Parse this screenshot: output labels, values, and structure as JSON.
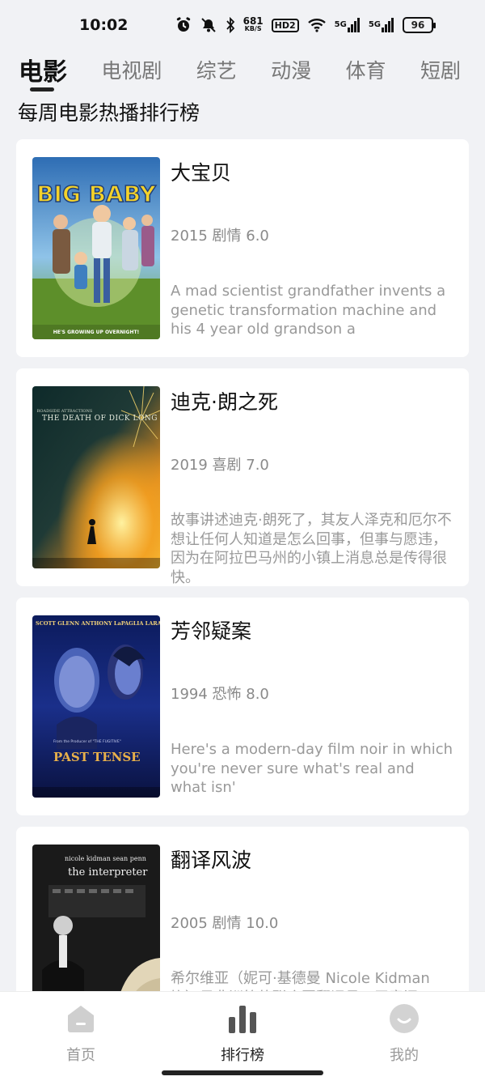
{
  "status_bar": {
    "time": "10:02",
    "net_speed_value": "681",
    "net_speed_unit": "KB/S",
    "hd_label": "HD2",
    "signal1_label": "5G",
    "signal2_label": "5G",
    "battery": "96"
  },
  "tabs": [
    {
      "label": "电影",
      "active": true
    },
    {
      "label": "电视剧"
    },
    {
      "label": "综艺"
    },
    {
      "label": "动漫"
    },
    {
      "label": "体育"
    },
    {
      "label": "短剧"
    }
  ],
  "section_title": "每周电影热播排行榜",
  "movies": [
    {
      "title": "大宝贝",
      "meta": "2015 剧情 6.0",
      "description": "A mad scientist grandfather invents a genetic transformation machine and his 4 year old grandson a",
      "poster_text": "BIG BABY",
      "poster_tagline": "HE'S GROWING UP OVERNIGHT!"
    },
    {
      "title": "迪克·朗之死",
      "meta": "2019 喜剧 7.0",
      "description": "故事讲述迪克·朗死了，其友人泽克和厄尔不想让任何人知道是怎么回事，但事与愿违，因为在阿拉巴马州的小镇上消息总是传得很快。",
      "poster_text": "THE DEATH OF DICK LONG"
    },
    {
      "title": "芳邻疑案",
      "meta": "1994 恐怖 8.0",
      "description": "Here's a modern-day film noir in which you're never sure what's real and what isn'",
      "poster_text": "PAST TENSE",
      "poster_names": "SCOTT GLENN   ANTHONY LaPAGLIA   LARA FLYNN BOYLE"
    },
    {
      "title": "翻译风波",
      "meta": "2005 剧情 10.0",
      "description": "希尔维亚（妮可·基德曼 Nicole Kidman 饰）是非洲籍的联合国翻译员。无意间",
      "poster_text": "the interpreter",
      "poster_names": "nicole kidman  sean penn"
    }
  ],
  "bottom_nav": [
    {
      "label": "首页",
      "icon": "home-icon"
    },
    {
      "label": "排行榜",
      "icon": "ranking-icon",
      "active": true
    },
    {
      "label": "我的",
      "icon": "profile-icon"
    }
  ]
}
